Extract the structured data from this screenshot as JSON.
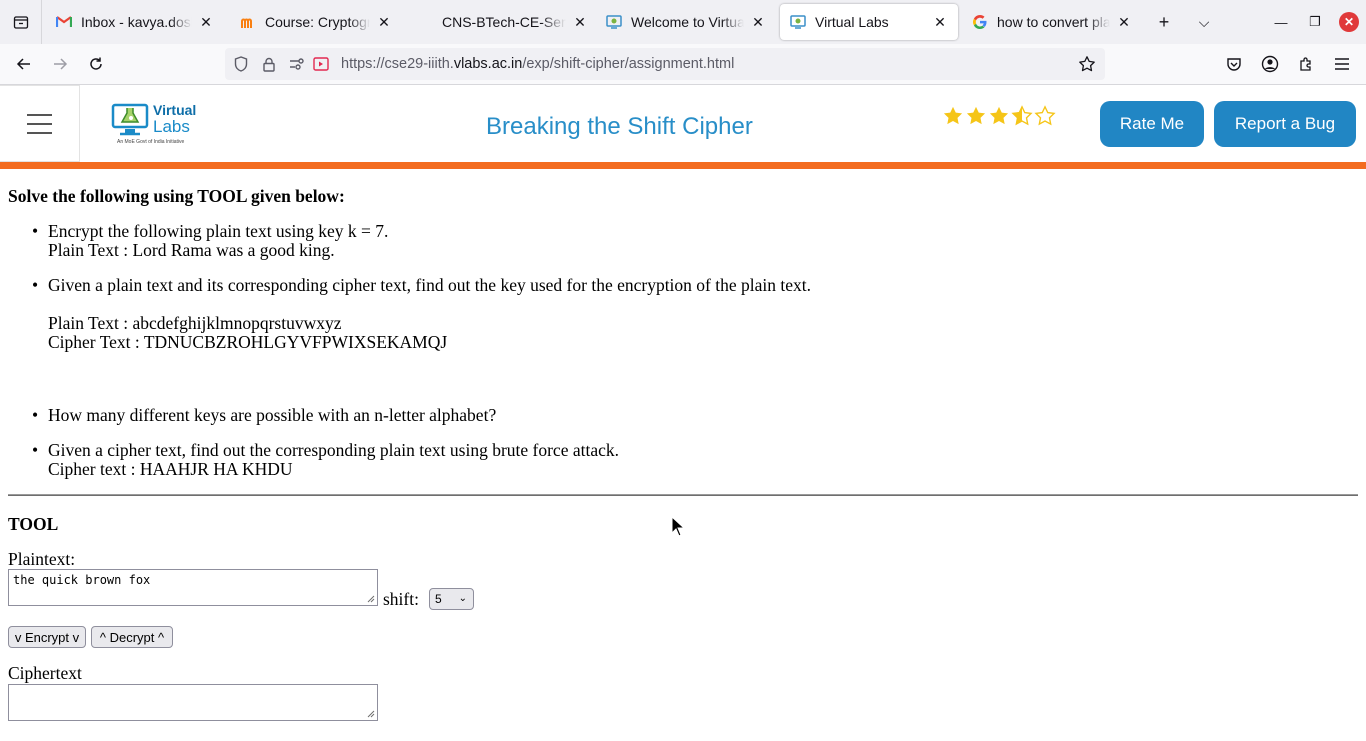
{
  "browser": {
    "tabs": [
      {
        "title": "Inbox - kavya.doshi@",
        "favicon": "gmail-icon",
        "active": false
      },
      {
        "title": "Course: Cryptography",
        "favicon": "moodle-icon",
        "active": false
      },
      {
        "title": "CNS-BTech-CE-Sem",
        "favicon": "none",
        "active": false
      },
      {
        "title": "Welcome to Virtual Labs",
        "favicon": "vlabs-icon",
        "active": false
      },
      {
        "title": "Virtual Labs",
        "favicon": "vlabs-icon",
        "active": true
      },
      {
        "title": "how to convert plain",
        "favicon": "google-icon",
        "active": false
      }
    ],
    "url": {
      "prefix": "https://cse29-iiith.",
      "host": "vlabs.ac.in",
      "path": "/exp/shift-cipher/assignment.html"
    }
  },
  "header": {
    "logo_line1": "Virtual",
    "logo_line2": "Labs",
    "logo_subtitle": "An MoE Govt of India Initiative",
    "title": "Breaking the Shift Cipher",
    "rating": 3.5,
    "rate_label": "Rate Me",
    "bug_label": "Report a Bug",
    "accent": "#2186c4",
    "bar_color": "#f36c20"
  },
  "assignment": {
    "heading": "Solve the following using TOOL given below:",
    "questions": [
      {
        "line1": "Encrypt the following plain text using key k = 7.",
        "line2": "Plain Text : Lord Rama was a good king."
      },
      {
        "line1": "Given a plain text and its corresponding cipher text, find out the key used for the encryption of the plain text.",
        "line2": "Plain Text : abcdefghijklmnopqrstuvwxyz",
        "line3": "Cipher Text : TDNUCBZROHLGYVFPWIXSEKAMQJ"
      },
      {
        "line1": "How many different keys are possible with an n-letter alphabet?"
      },
      {
        "line1": "Given a cipher text, find out the corresponding plain text using brute force attack.",
        "line2": "Cipher text : HAAHJR HA KHDU"
      }
    ]
  },
  "tool": {
    "title": "TOOL",
    "plaintext_label": "Plaintext:",
    "plaintext_value": "the quick brown fox",
    "shift_label": "shift:",
    "shift_value": "5",
    "encrypt_label": "v Encrypt v",
    "decrypt_label": "^ Decrypt ^",
    "ciphertext_label": "Ciphertext",
    "ciphertext_value": ""
  }
}
